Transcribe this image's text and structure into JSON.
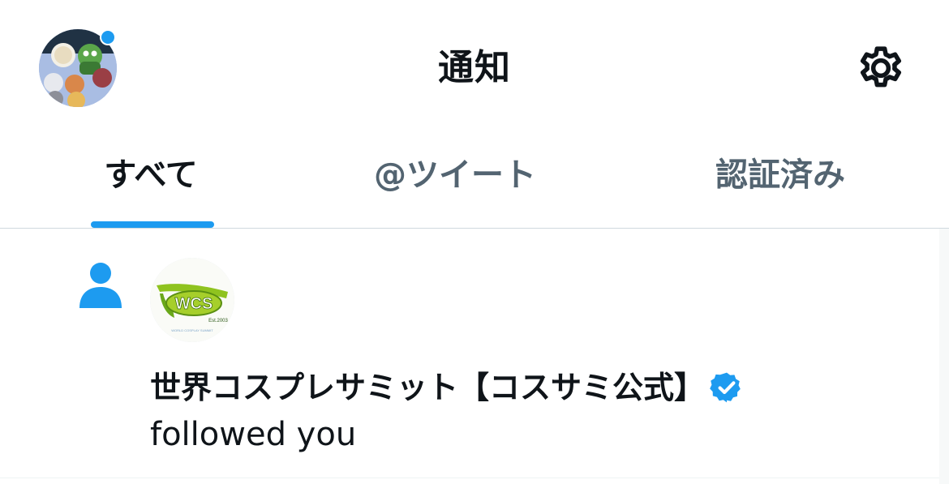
{
  "header": {
    "title": "通知",
    "avatar_icon": "user-avatar-icon",
    "settings_icon": "gear-icon",
    "notification_dot_color": "#1d9bf0"
  },
  "tabs": [
    {
      "label": "すべて",
      "active": true
    },
    {
      "label": "@ツイート",
      "active": false
    },
    {
      "label": "認証済み",
      "active": false
    }
  ],
  "accent_color": "#1d9bf0",
  "notification": {
    "type_icon": "person-icon",
    "avatar_logo_text": "WCS",
    "avatar_logo_subtext": "Est.2003",
    "avatar_logo_caption": "WORLD COSPLAY SUMMIT",
    "account_name": "世界コスプレサミット【コスサミ公式】",
    "verified": true,
    "verified_icon": "verified-badge-icon",
    "action": "followed you"
  }
}
